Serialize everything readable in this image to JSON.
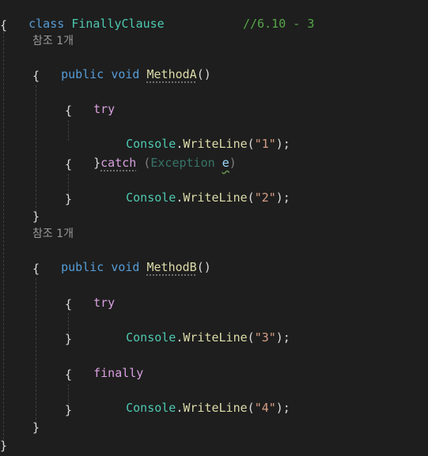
{
  "code": {
    "class_keyword": "class",
    "class_name": "FinallyClause",
    "class_comment": "//6.10 - 3",
    "brace_open": "{",
    "brace_close": "}",
    "codelens_a": "참조 1개",
    "codelens_b": "참조 1개",
    "public_kw": "public",
    "void_kw": "void",
    "method_a": "MethodA",
    "method_b": "MethodB",
    "parens": "()",
    "try_kw": "try",
    "catch_kw": "catch",
    "finally_kw": "finally",
    "exception_open": "(",
    "exception_type": "Exception",
    "exception_var": "e",
    "exception_close": ")",
    "console": "Console",
    "dot": ".",
    "writeline": "WriteLine",
    "paren_open": "(",
    "paren_close_semi": ");",
    "str1": "\"1\"",
    "str2": "\"2\"",
    "str3": "\"3\"",
    "str4": "\"4\""
  },
  "colors": {
    "background": "#1e1e1e",
    "keyword": "#569cd6",
    "control_keyword": "#d8a0df",
    "type": "#4ec9b0",
    "method": "#dcdcaa",
    "string": "#d69d85",
    "comment": "#57a64a",
    "codelens": "#999999"
  }
}
